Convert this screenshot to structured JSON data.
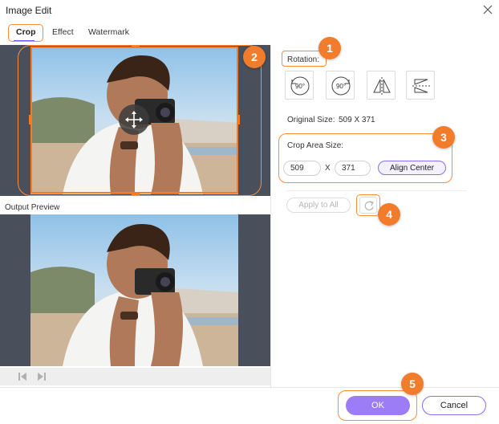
{
  "window": {
    "title": "Image Edit"
  },
  "tabs": [
    {
      "label": "Crop",
      "active": true
    },
    {
      "label": "Effect",
      "active": false
    },
    {
      "label": "Watermark",
      "active": false
    }
  ],
  "preview": {
    "label": "Output Preview"
  },
  "rotation": {
    "label": "Rotation:",
    "buttons": [
      {
        "icon": "rotate-left-90-icon",
        "text": "90°"
      },
      {
        "icon": "rotate-right-90-icon",
        "text": "90°"
      },
      {
        "icon": "flip-horizontal-icon"
      },
      {
        "icon": "flip-vertical-icon"
      }
    ]
  },
  "original_size": {
    "label": "Original Size:",
    "value": "509 X 371"
  },
  "crop_area": {
    "label": "Crop Area Size:",
    "width": "509",
    "separator": "X",
    "height": "371",
    "align_label": "Align Center"
  },
  "apply_all_label": "Apply to All",
  "footer": {
    "ok_label": "OK",
    "cancel_label": "Cancel"
  },
  "callouts": [
    "1",
    "2",
    "3",
    "4",
    "5"
  ],
  "colors": {
    "accent_purple": "#9d7cf7",
    "callout_orange": "#f07c2c",
    "crop_frame": "#ff7a1a",
    "panel_dark": "#4a4f5c"
  }
}
